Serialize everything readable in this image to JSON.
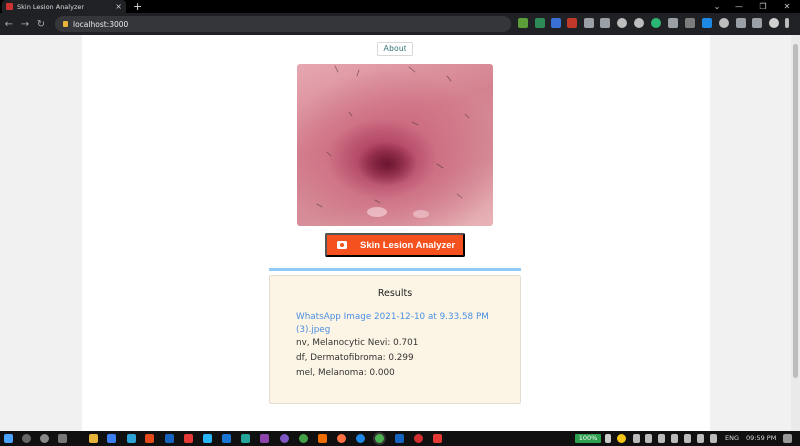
{
  "browser": {
    "tab_title": "Skin Lesion Analyzer",
    "new_tab_symbol": "+",
    "url": "localhost:3000",
    "window_controls": [
      "⌄",
      "—",
      "❐",
      "✕"
    ]
  },
  "page": {
    "about_label": "About",
    "analyzer_label": "Skin Lesion Analyzer",
    "progress_fraction": 1.0,
    "results": {
      "title": "Results",
      "file_name": "WhatsApp Image 2021-12-10 at 9.33.58 PM (3).jpeg",
      "predictions": [
        "nv, Melanocytic Nevi: 0.701",
        "df, Dermatofibroma: 0.299",
        "mel, Melanoma: 0.000"
      ]
    }
  },
  "taskbar": {
    "battery": "100%",
    "language": "ENG",
    "time": "09:59 PM"
  },
  "colors": {
    "accent": "#f4511e",
    "progress": "#90caf9",
    "results_bg": "#fcf4e4",
    "link": "#4a90e2"
  }
}
